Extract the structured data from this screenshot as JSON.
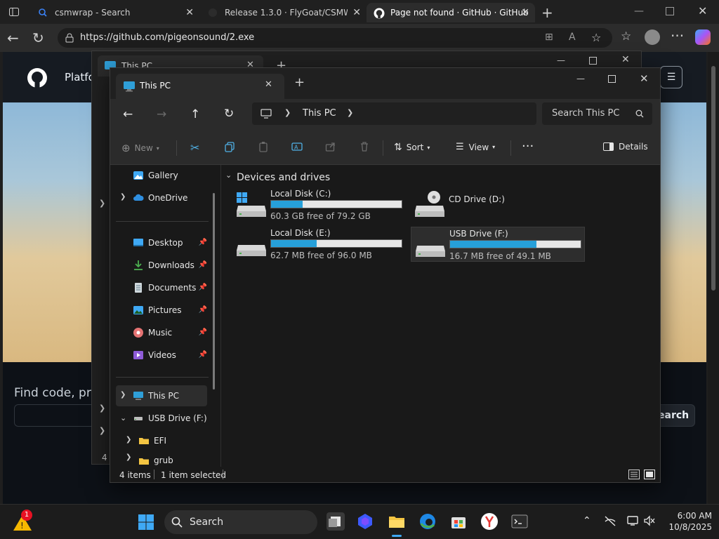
{
  "browser": {
    "tabs": [
      {
        "label": "csmwrap - Search"
      },
      {
        "label": "Release 1.3.0 · FlyGoat/CSMWrap"
      },
      {
        "label": "Page not found · GitHub · GitHub"
      }
    ],
    "url": "https://github.com/pigeonsound/2.exe"
  },
  "github": {
    "nav_partial": "Platfo",
    "search_prompt": "Find code, proj",
    "search_button": "earch"
  },
  "back_window": {
    "tab_title": "This PC",
    "status_partial": "4 i"
  },
  "explorer": {
    "tab_title": "This PC",
    "breadcrumb": "This PC",
    "search_placeholder": "Search This PC",
    "toolbar": {
      "new_label": "New",
      "sort_label": "Sort",
      "view_label": "View",
      "details_label": "Details"
    },
    "nav": {
      "gallery": "Gallery",
      "onedrive": "OneDrive",
      "desktop": "Desktop",
      "downloads": "Downloads",
      "documents": "Documents",
      "pictures": "Pictures",
      "music": "Music",
      "videos": "Videos",
      "this_pc": "This PC",
      "usb_drive": "USB Drive (F:)",
      "efi": "EFI",
      "grub": "grub"
    },
    "section_title": "Devices and drives",
    "drives": [
      {
        "name": "Local Disk (C:)",
        "free_text": "60.3 GB free of 79.2 GB",
        "used_fraction": 0.24
      },
      {
        "name": "CD Drive (D:)"
      },
      {
        "name": "Local Disk (E:)",
        "free_text": "62.7 MB free of 96.0 MB",
        "used_fraction": 0.35
      },
      {
        "name": "USB Drive (F:)",
        "free_text": "16.7 MB free of 49.1 MB",
        "used_fraction": 0.66
      }
    ],
    "status": {
      "item_count": "4 items",
      "selected": "1 item selected"
    }
  },
  "taskbar": {
    "search_label": "Search",
    "notification_count": "1",
    "time": "6:00 AM",
    "date": "10/8/2025"
  },
  "colors": {
    "accent": "#26a0da",
    "github_dark": "#0d1117"
  }
}
